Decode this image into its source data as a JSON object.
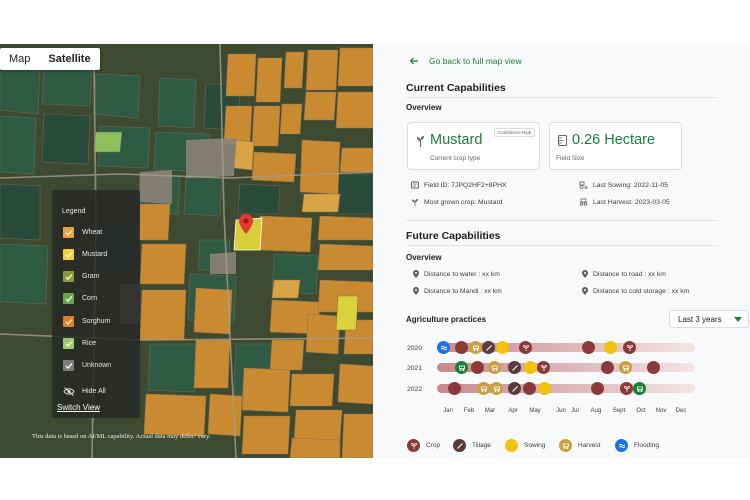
{
  "map": {
    "toggle": {
      "map": "Map",
      "satellite": "Satellite"
    },
    "legend": {
      "title": "Legend",
      "items": [
        {
          "label": "Wheat",
          "color": "#f0a03a"
        },
        {
          "label": "Mustard",
          "color": "#f4d03f"
        },
        {
          "label": "Gram",
          "color": "#8b9b3a"
        },
        {
          "label": "Corn",
          "color": "#6aa84f"
        },
        {
          "label": "Sorghum",
          "color": "#e67e22"
        },
        {
          "label": "Rice",
          "color": "#9ccc65"
        },
        {
          "label": "Unknown",
          "color": "#7b7b7b"
        }
      ],
      "hide_all": "Hide All",
      "switch_view": "Switch View"
    },
    "disclaimer": "This data is based on AI/ML capability. Actual data may differ/ vary."
  },
  "panel": {
    "back_label": "Go back to full map view",
    "current_title": "Current Capabilities",
    "overview": "Overview",
    "crop_card": {
      "value": "Mustard",
      "sub": "Current crop type",
      "badge": "Confidence:High"
    },
    "field_card": {
      "value": "0.26 Hectare",
      "sub": "Field Size"
    },
    "info": {
      "field_id": "Field ID: 7JPQ2HF2+8PHX",
      "last_sowing": "Last Sowing: 2022-11-05",
      "most_grown": "Most grown crop: Mustard",
      "last_harvest": "Last Harvest: 2023-03-05"
    },
    "future_title": "Future Capabilities",
    "future_overview": "Overview",
    "distances": {
      "water": "Distance to water : xx km",
      "road": "Distance to road : xx km",
      "mandi": "Distance to Mandi : xx km",
      "cold_storage": "Distance to cold storage : xx km"
    },
    "practices_title": "Agriculture practices",
    "range_select": "Last 3 years",
    "years": [
      "2020",
      "2021",
      "2022"
    ],
    "months": [
      "Jan",
      "Feb",
      "Mar",
      "Apr",
      "May",
      "Jun",
      "Jul",
      "Aug",
      "Sept",
      "Oct",
      "Nov",
      "Dec"
    ],
    "legend": {
      "crop": "Crop",
      "tillage": "Tillage",
      "sowing": "Sowing",
      "harvest": "Harvest",
      "flooding": "Flooding"
    },
    "colors": {
      "crop": "#8b3a3a",
      "tillage": "#5a3a3a",
      "sowing": "#f4c20d",
      "harvest": "#c8a040",
      "flooding": "#1a73e8",
      "accent": "#188038"
    }
  }
}
